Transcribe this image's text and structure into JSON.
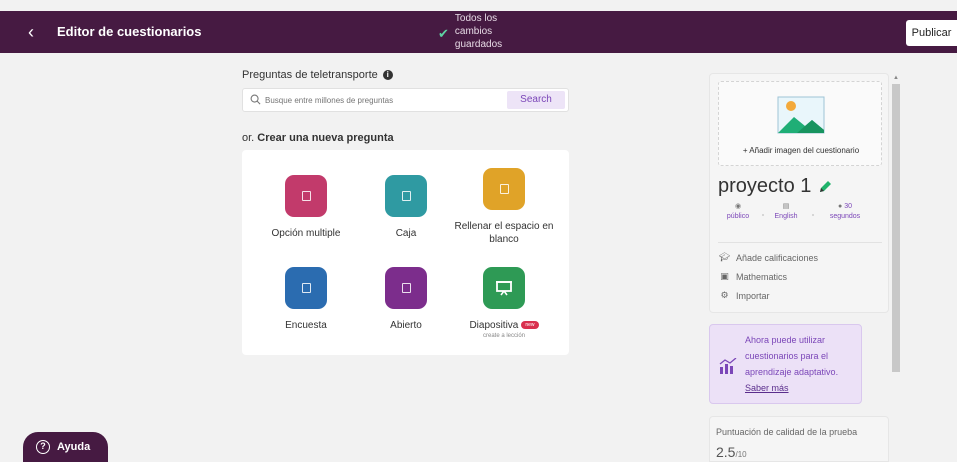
{
  "header": {
    "title": "Editor de cuestionarios",
    "saved_status": "Todos los cambios guardados",
    "publish_label": "Publicar",
    "back_icon": "chevron-left-icon",
    "saved_icon": "check-icon"
  },
  "teleport": {
    "title": "Preguntas de teletransporte",
    "info_icon": "info-icon",
    "search": {
      "placeholder": "Busque entre millones de preguntas",
      "button_label": "Search"
    }
  },
  "create": {
    "prefix": "or.",
    "label": "Crear una nueva pregunta"
  },
  "question_types": [
    {
      "label": "Opción multiple",
      "color": "#c23a6b",
      "icon": "square-icon"
    },
    {
      "label": "Caja",
      "color": "#2f9aa2",
      "icon": "square-icon"
    },
    {
      "label": "Rellenar el espacio en blanco",
      "color": "#e0a328",
      "icon": "square-icon"
    },
    {
      "label": "Encuesta",
      "color": "#2b6cb0",
      "icon": "square-icon"
    },
    {
      "label": "Abierto",
      "color": "#7c2d8c",
      "icon": "square-icon"
    },
    {
      "label": "Diapositiva",
      "badge": "new",
      "sublabel": "create a lección",
      "color": "#2e9a55",
      "icon": "presentation-icon"
    }
  ],
  "quiz": {
    "add_image_label": "+ Añadir imagen del cuestionario",
    "name": "proyecto 1",
    "meta": [
      {
        "icon": "eye-icon",
        "label": "público"
      },
      {
        "icon": "language-icon",
        "label": "English"
      },
      {
        "icon": "clock-icon",
        "value": "30",
        "label": "segundos"
      }
    ],
    "settings": [
      {
        "icon": "graduation-cap-icon",
        "label": "Añade calificaciones"
      },
      {
        "icon": "book-icon",
        "label": "Mathematics"
      },
      {
        "icon": "import-icon",
        "label": "Importar"
      }
    ]
  },
  "adaptive": {
    "text": "Ahora puede utilizar cuestionarios para el aprendizaje adaptativo.",
    "link": "Saber más"
  },
  "quality": {
    "label": "Puntuación de calidad de la prueba",
    "score": "2.5",
    "max": "/10"
  },
  "help": {
    "label": "Ayuda"
  },
  "colors": {
    "header_bg": "#461a42",
    "accent_purple": "#7b46b8",
    "success_green": "#5ed3a3"
  }
}
